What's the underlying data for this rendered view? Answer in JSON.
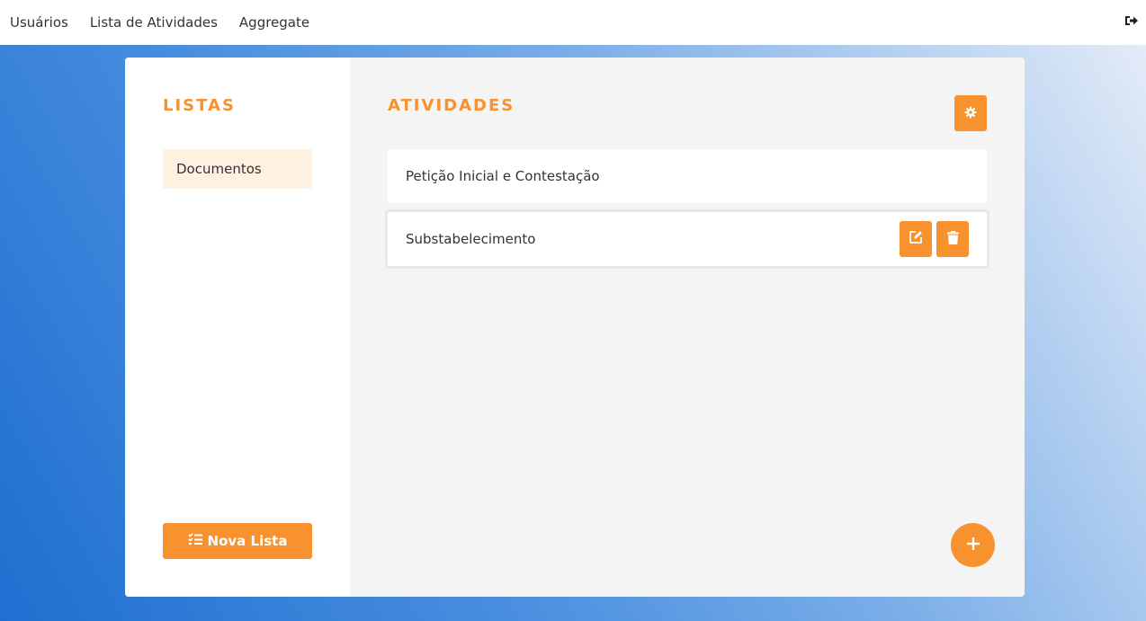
{
  "nav": {
    "items": [
      "Usuários",
      "Lista de Atividades",
      "Aggregate"
    ],
    "logout_icon": "sign-out-icon"
  },
  "sidebar": {
    "title": "LISTAS",
    "lists": [
      {
        "label": "Documentos"
      }
    ],
    "new_list_label": "Nova Lista",
    "new_list_icon": "tasks-icon"
  },
  "main": {
    "title": "ATIVIDADES",
    "settings_icon": "gear-icon",
    "activities": [
      {
        "label": "Petição Inicial e Contestação"
      },
      {
        "label": "Substabelecimento"
      }
    ],
    "edit_icon": "edit-icon",
    "delete_icon": "trash-icon",
    "add_icon": "plus-icon"
  },
  "colors": {
    "accent": "#f7922f",
    "selected_bg": "#fef1e2",
    "panel_bg": "#f4f4f4"
  }
}
